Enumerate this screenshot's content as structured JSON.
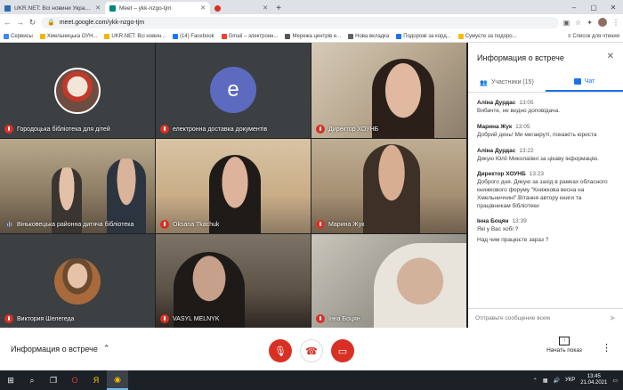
{
  "browser": {
    "tabs": [
      {
        "title": "UKR.NET: Всі новини України, о",
        "favicon_color": "#2a6db5",
        "active": false
      },
      {
        "title": "Meet – ykk-nzgo-tjm",
        "favicon_color": "#00897b",
        "active": true
      },
      {
        "title": "",
        "favicon_color": "#d93025",
        "active": false
      }
    ],
    "new_tab_icon": "plus-icon",
    "url": "meet.google.com/ykk-nzgo-tjm",
    "bookmarks": [
      {
        "label": "Сервисы",
        "color": "#4285f4"
      },
      {
        "label": "Хмельницька ОУН...",
        "color": "#f4b400"
      },
      {
        "label": "UKR.NET: Всі новин...",
        "color": "#f4b400"
      },
      {
        "label": "(14) Facebook",
        "color": "#1877f2"
      },
      {
        "label": "Gmail – электронн...",
        "color": "#ea4335"
      },
      {
        "label": "Мережа центрів е...",
        "color": "#555555"
      },
      {
        "label": "Нова вкладка",
        "color": "#5f6368"
      },
      {
        "label": "Подорожі за корд...",
        "color": "#1a73e8"
      },
      {
        "label": "Сумуєте за подоро...",
        "color": "#fbbc04"
      }
    ],
    "reading_list": "Список для чтения"
  },
  "tiles": [
    {
      "name": "Городоцька бібліотека для дітей",
      "mic": "off",
      "kind": "logo",
      "bg": "#3c4043"
    },
    {
      "name": "електронна доставка документів",
      "mic": "off",
      "kind": "initial",
      "initial": "e",
      "bg": "#3c4043",
      "avatar_color": "#5c6bc0"
    },
    {
      "name": "Директор ХОУНБ",
      "mic": "off",
      "kind": "video",
      "bg": "#b7a78f"
    },
    {
      "name": "Віньковецька районна дитяча бібліотека",
      "mic": "on",
      "kind": "video",
      "bg": "#8a7a62"
    },
    {
      "name": "Oksana Tkachuk",
      "mic": "off",
      "kind": "video",
      "bg": "#c9ad87"
    },
    {
      "name": "Марина Жук",
      "mic": "off",
      "kind": "video",
      "bg": "#a58f72"
    },
    {
      "name": "Виктория Шелегеда",
      "mic": "off",
      "kind": "photo",
      "bg": "#3c4043"
    },
    {
      "name": "VASYL MELNYK",
      "mic": "off",
      "kind": "video",
      "bg": "#5d5246"
    },
    {
      "name": "Інна Боцян",
      "mic": "off",
      "kind": "video",
      "bg": "#9c9a90"
    }
  ],
  "panel": {
    "title": "Информация о встрече",
    "tabs": [
      {
        "label": "Участники (15)",
        "icon": "people-icon",
        "active": false
      },
      {
        "label": "Чат",
        "icon": "chat-icon",
        "active": true
      }
    ],
    "messages": [
      {
        "author": "Аліна Дурдас",
        "time": "13:05",
        "lines": [
          "Вибачте, не видно доповідача."
        ]
      },
      {
        "author": "Марина Жук",
        "time": "13:05",
        "lines": [
          "Добрий день! Ми мегакруті, покажіть юриста"
        ]
      },
      {
        "author": "Аліна Дурдас",
        "time": "13:22",
        "lines": [
          "Дякую Юлії Миколаївні  за цікаву інформацію."
        ]
      },
      {
        "author": "Директор ХОУНБ",
        "time": "13:23",
        "lines": [
          "Доброго дня. Дякую за захід в рамках обласного книжкового форуму \"Книжкова весна на Хмельниччині\".Вітання автору книги та працівникам бібліотеки"
        ]
      },
      {
        "author": "Інна Боцян",
        "time": "13:39",
        "lines": [
          "Які у Вас хобі ?",
          "Над чим працюєте зараз ?"
        ]
      }
    ],
    "compose_placeholder": "Отправьте сообщение всем"
  },
  "bottom": {
    "meeting_info": "Информация о встрече",
    "present_label": "Начать показ"
  },
  "taskbar": {
    "language": "УКР",
    "time": "13:45",
    "date": "21.04.2021"
  }
}
